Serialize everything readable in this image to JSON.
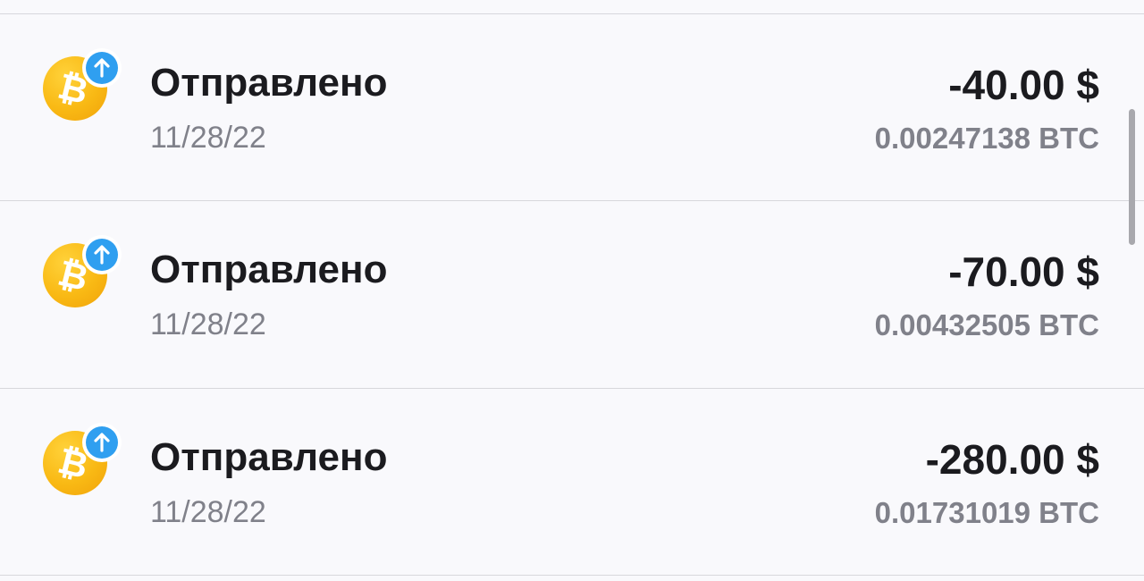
{
  "transactions": [
    {
      "type_label": "Отправлено",
      "date": "11/28/22",
      "fiat_amount": "-40.00 $",
      "crypto_amount": "0.00247138 BTC",
      "icon": "bitcoin-icon",
      "badge_icon": "arrow-up-icon"
    },
    {
      "type_label": "Отправлено",
      "date": "11/28/22",
      "fiat_amount": "-70.00 $",
      "crypto_amount": "0.00432505 BTC",
      "icon": "bitcoin-icon",
      "badge_icon": "arrow-up-icon"
    },
    {
      "type_label": "Отправлено",
      "date": "11/28/22",
      "fiat_amount": "-280.00 $",
      "crypto_amount": "0.01731019 BTC",
      "icon": "bitcoin-icon",
      "badge_icon": "arrow-up-icon"
    }
  ],
  "colors": {
    "background": "#f9f9fc",
    "primary_text": "#1b1b1f",
    "secondary_text": "#80818a",
    "coin": "#f9b914",
    "badge": "#2f9ff0",
    "divider": "#d7d7dc"
  }
}
